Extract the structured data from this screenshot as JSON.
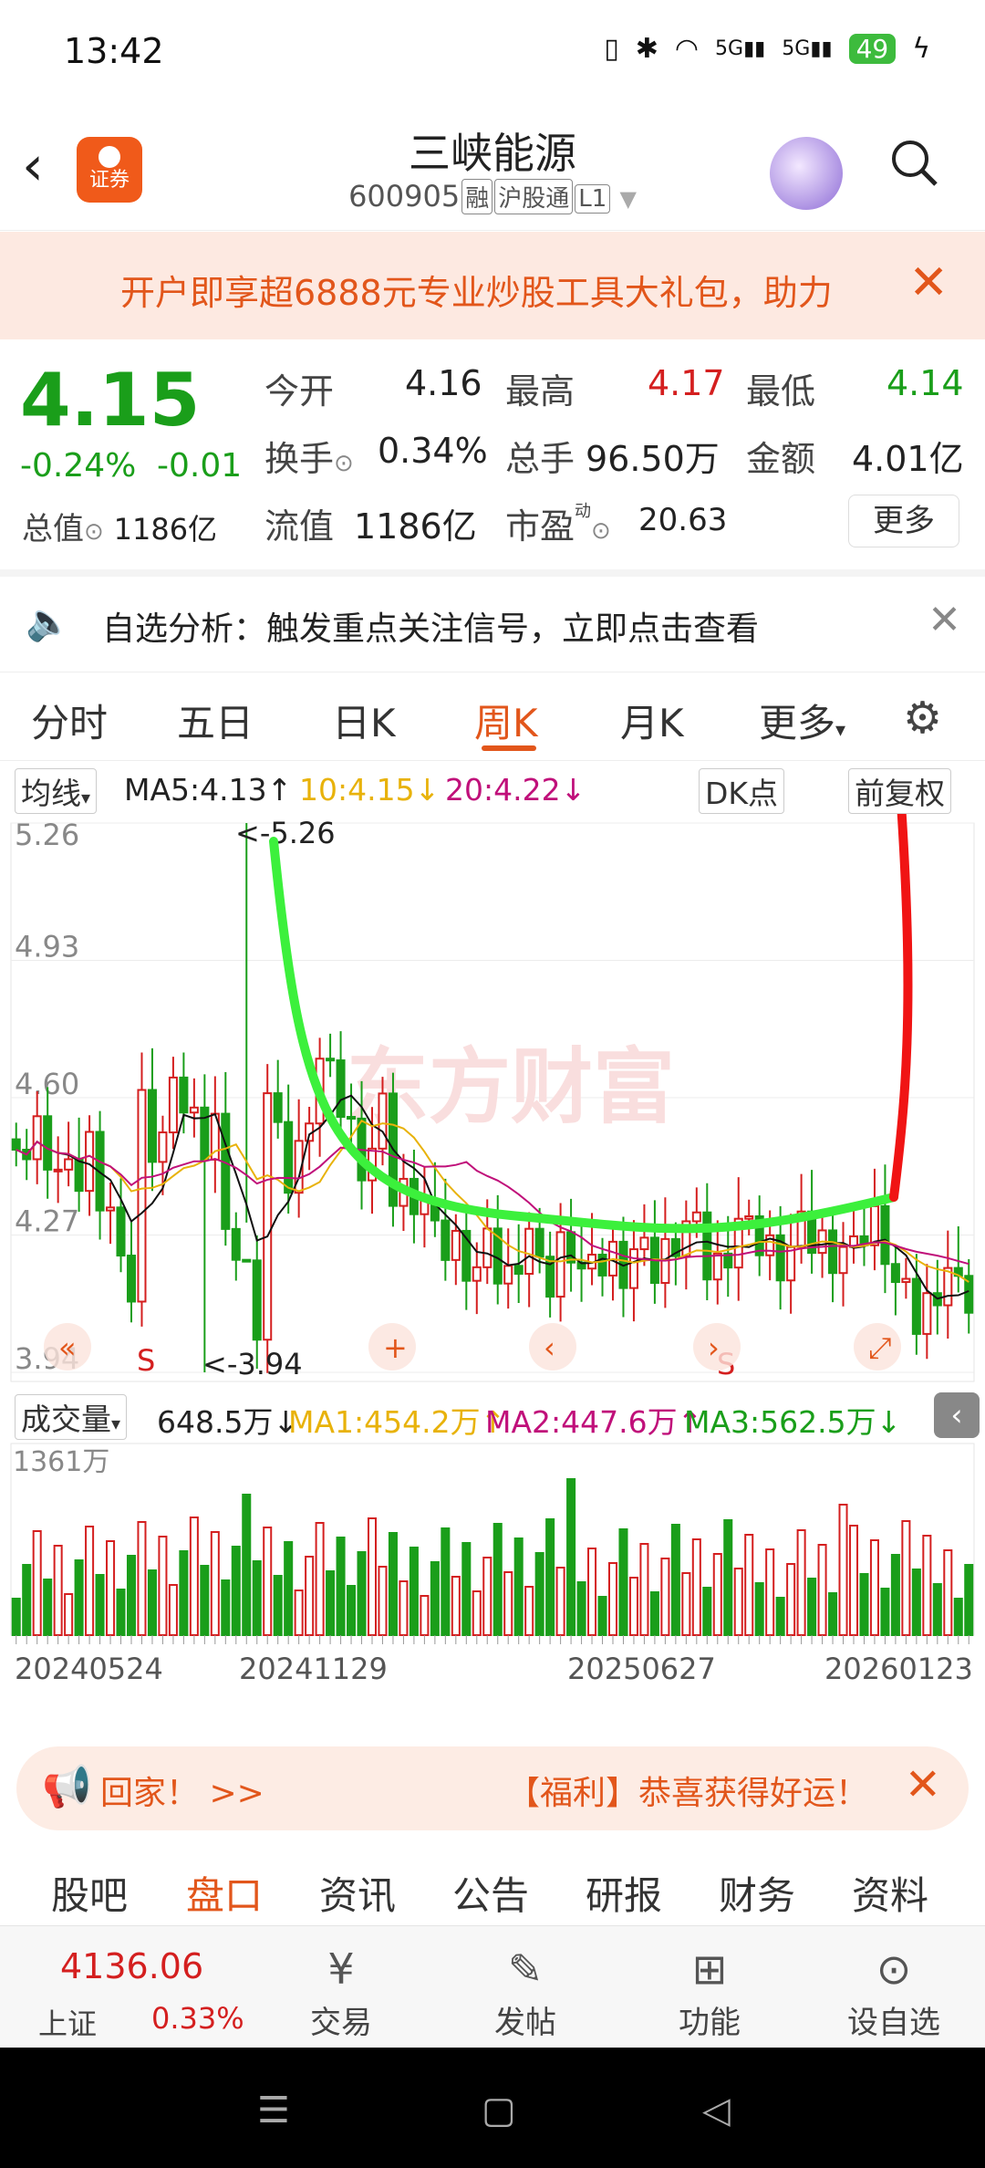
{
  "status_bar": {
    "time": "13:42",
    "signal_1": "5G",
    "signal_2": "5G",
    "battery": "49"
  },
  "header": {
    "title": "三峡能源",
    "code": "600905",
    "tags": [
      "融",
      "沪股通",
      "L1"
    ],
    "logo_text": "证券"
  },
  "promo": {
    "text": "开户即享超6888元专业炒股工具大礼包，助力"
  },
  "quote": {
    "price": "4.15",
    "change_pct": "-0.24%",
    "change": "-0.01",
    "labels": {
      "open": "今开",
      "high": "最高",
      "low": "最低",
      "turnover_rate": "换手",
      "volume": "总手",
      "amount": "金额",
      "total_value": "总值",
      "float_value": "流值",
      "pe": "市盈"
    },
    "values": {
      "open": "4.16",
      "high": "4.17",
      "low": "4.14",
      "turnover_rate": "0.34%",
      "volume": "96.50万",
      "amount": "4.01亿",
      "total_value": "1186亿",
      "float_value": "1186亿",
      "pe": "20.63"
    },
    "more": "更多"
  },
  "analysis": {
    "text": "自选分析：触发重点关注信号，立即点击查看"
  },
  "tabs": [
    {
      "label": "分时"
    },
    {
      "label": "五日"
    },
    {
      "label": "日K"
    },
    {
      "label": "周K"
    },
    {
      "label": "月K"
    },
    {
      "label": "更多"
    }
  ],
  "ma_row": {
    "selector": "均线",
    "ma5": "MA5:4.13",
    "ma10": "10:4.15",
    "ma20": "20:4.22",
    "dk": "DK点",
    "adjust": "前复权"
  },
  "vol_row": {
    "selector": "成交量",
    "vol": "648.5万",
    "ma1": "MA1:454.2万",
    "ma2": "MA2:447.6万",
    "ma3": "MA3:562.5万"
  },
  "chart_data": {
    "type": "candlestick",
    "y_ticks": [
      "5.26",
      "4.93",
      "4.60",
      "4.27",
      "3.94"
    ],
    "ylim": [
      3.94,
      5.26
    ],
    "max_label": "<-5.26",
    "min_label": "<-3.94",
    "x_ticks": [
      "20240524",
      "20241129",
      "20250627",
      "20260123"
    ],
    "volume_label": "1361万",
    "markers": [
      "S",
      "S"
    ],
    "colors": {
      "up": "#d41f1f",
      "down": "#1a9e1a",
      "ma5": "#111111",
      "ma10": "#e8b20a",
      "ma20": "#c0107a"
    }
  },
  "ticker": {
    "t1": "回家！ >>",
    "t2": "【福利】恭喜获得好运！"
  },
  "subtabs": [
    {
      "label": "股吧"
    },
    {
      "label": "盘口"
    },
    {
      "label": "资讯"
    },
    {
      "label": "公告"
    },
    {
      "label": "研报"
    },
    {
      "label": "财务"
    },
    {
      "label": "资料"
    }
  ],
  "bottom_nav": {
    "index_value": "4136.06",
    "index_name": "上证",
    "index_pct": "0.33%",
    "items": [
      {
        "label": "交易"
      },
      {
        "label": "发帖"
      },
      {
        "label": "功能"
      },
      {
        "label": "设自选"
      }
    ]
  }
}
